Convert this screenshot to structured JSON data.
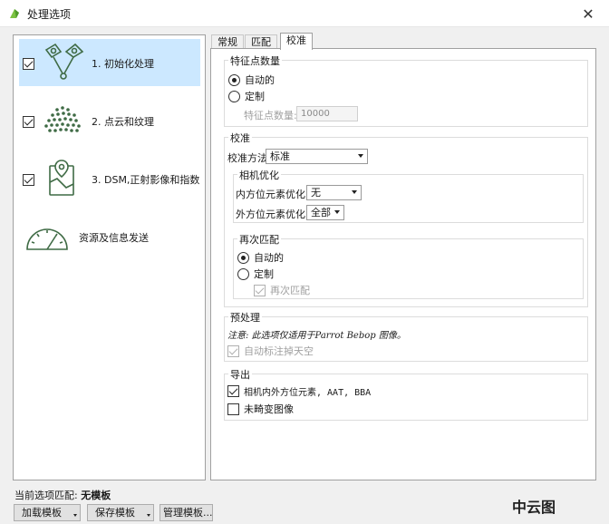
{
  "window": {
    "title": "处理选项",
    "close_glyph": "✕"
  },
  "steps": [
    {
      "label": "1. 初始化处理",
      "checked": true,
      "selected": true,
      "icon": "initial-processing-icon"
    },
    {
      "label": "2. 点云和纹理",
      "checked": true,
      "selected": false,
      "icon": "point-cloud-icon"
    },
    {
      "label": "3. DSM,正射影像和指数",
      "checked": true,
      "selected": false,
      "icon": "dsm-map-icon"
    },
    {
      "label": "资源及信息发送",
      "icon": "gauge-icon"
    }
  ],
  "tabs": [
    {
      "label": "常规",
      "active": false
    },
    {
      "label": "匹配",
      "active": false
    },
    {
      "label": "校准",
      "active": true
    }
  ],
  "keypoints": {
    "title": "特征点数量",
    "auto_label": "自动的",
    "custom_label": "定制",
    "count_label": "特征点数量:",
    "count_value": "10000"
  },
  "calibration": {
    "title": "校准",
    "method_label": "校准方法",
    "method_value": "标准",
    "camera_opt_title": "相机优化",
    "internal_label": "内方位元素优化:",
    "internal_value": "无",
    "external_label": "外方位元素优化:",
    "external_value": "全部",
    "rematch_title": "再次匹配",
    "rematch_auto": "自动的",
    "rematch_custom": "定制",
    "rematch_check": "再次匹配"
  },
  "preprocessing": {
    "title": "预处理",
    "note": "注意: 此选项仅适用于Parrot Bebop 图像。",
    "sky_label": "自动标注掉天空"
  },
  "export": {
    "title": "导出",
    "camera_params_label": "相机内外方位元素, AAT, BBA",
    "undistorted_label": "未畸变图像"
  },
  "status": {
    "label": "当前选项匹配:",
    "value": "无模板"
  },
  "buttons": {
    "load": "加载模板",
    "save": "保存模板",
    "manage": "管理模板..."
  },
  "watermark": "中云图",
  "colors": {
    "selection": "#cce8ff",
    "icon_green": "#3f6b45"
  }
}
